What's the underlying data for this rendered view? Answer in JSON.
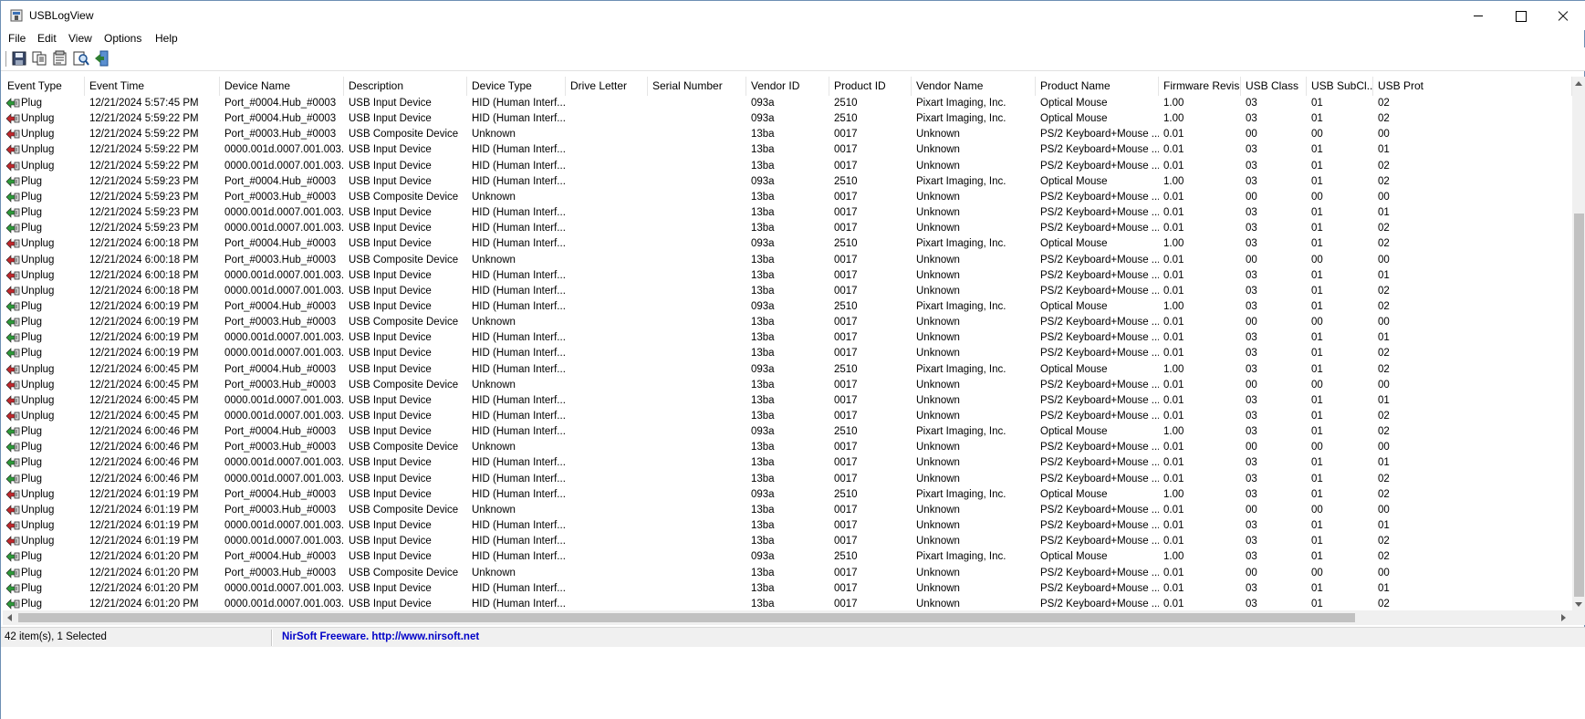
{
  "window": {
    "title": "USBLogView"
  },
  "menu": [
    "File",
    "Edit",
    "View",
    "Options",
    "Help"
  ],
  "toolbar": [
    {
      "name": "save-icon"
    },
    {
      "name": "copy-icon"
    },
    {
      "name": "properties-icon"
    },
    {
      "name": "find-icon"
    },
    {
      "name": "exit-icon"
    }
  ],
  "columns": [
    "Event Type",
    "Event Time",
    "Device Name",
    "Description",
    "Device Type",
    "Drive Letter",
    "Serial Number",
    "Vendor ID",
    "Product ID",
    "Vendor Name",
    "Product Name",
    "Firmware Revisi...",
    "USB Class",
    "USB SubCl...",
    "USB Prot"
  ],
  "rows": [
    [
      "Plug",
      "12/21/2024 5:57:45 PM",
      "Port_#0004.Hub_#0003",
      "USB Input Device",
      "HID (Human Interf...",
      "",
      "",
      "093a",
      "2510",
      "Pixart Imaging, Inc.",
      "Optical Mouse",
      "1.00",
      "03",
      "01",
      "02"
    ],
    [
      "Unplug",
      "12/21/2024 5:59:22 PM",
      "Port_#0004.Hub_#0003",
      "USB Input Device",
      "HID (Human Interf...",
      "",
      "",
      "093a",
      "2510",
      "Pixart Imaging, Inc.",
      "Optical Mouse",
      "1.00",
      "03",
      "01",
      "02"
    ],
    [
      "Unplug",
      "12/21/2024 5:59:22 PM",
      "Port_#0003.Hub_#0003",
      "USB Composite Device",
      "Unknown",
      "",
      "",
      "13ba",
      "0017",
      "Unknown",
      "PS/2 Keyboard+Mouse ...",
      "0.01",
      "00",
      "00",
      "00"
    ],
    [
      "Unplug",
      "12/21/2024 5:59:22 PM",
      "0000.001d.0007.001.003....",
      "USB Input Device",
      "HID (Human Interf...",
      "",
      "",
      "13ba",
      "0017",
      "Unknown",
      "PS/2 Keyboard+Mouse ...",
      "0.01",
      "03",
      "01",
      "01"
    ],
    [
      "Unplug",
      "12/21/2024 5:59:22 PM",
      "0000.001d.0007.001.003....",
      "USB Input Device",
      "HID (Human Interf...",
      "",
      "",
      "13ba",
      "0017",
      "Unknown",
      "PS/2 Keyboard+Mouse ...",
      "0.01",
      "03",
      "01",
      "02"
    ],
    [
      "Plug",
      "12/21/2024 5:59:23 PM",
      "Port_#0004.Hub_#0003",
      "USB Input Device",
      "HID (Human Interf...",
      "",
      "",
      "093a",
      "2510",
      "Pixart Imaging, Inc.",
      "Optical Mouse",
      "1.00",
      "03",
      "01",
      "02"
    ],
    [
      "Plug",
      "12/21/2024 5:59:23 PM",
      "Port_#0003.Hub_#0003",
      "USB Composite Device",
      "Unknown",
      "",
      "",
      "13ba",
      "0017",
      "Unknown",
      "PS/2 Keyboard+Mouse ...",
      "0.01",
      "00",
      "00",
      "00"
    ],
    [
      "Plug",
      "12/21/2024 5:59:23 PM",
      "0000.001d.0007.001.003....",
      "USB Input Device",
      "HID (Human Interf...",
      "",
      "",
      "13ba",
      "0017",
      "Unknown",
      "PS/2 Keyboard+Mouse ...",
      "0.01",
      "03",
      "01",
      "01"
    ],
    [
      "Plug",
      "12/21/2024 5:59:23 PM",
      "0000.001d.0007.001.003....",
      "USB Input Device",
      "HID (Human Interf...",
      "",
      "",
      "13ba",
      "0017",
      "Unknown",
      "PS/2 Keyboard+Mouse ...",
      "0.01",
      "03",
      "01",
      "02"
    ],
    [
      "Unplug",
      "12/21/2024 6:00:18 PM",
      "Port_#0004.Hub_#0003",
      "USB Input Device",
      "HID (Human Interf...",
      "",
      "",
      "093a",
      "2510",
      "Pixart Imaging, Inc.",
      "Optical Mouse",
      "1.00",
      "03",
      "01",
      "02"
    ],
    [
      "Unplug",
      "12/21/2024 6:00:18 PM",
      "Port_#0003.Hub_#0003",
      "USB Composite Device",
      "Unknown",
      "",
      "",
      "13ba",
      "0017",
      "Unknown",
      "PS/2 Keyboard+Mouse ...",
      "0.01",
      "00",
      "00",
      "00"
    ],
    [
      "Unplug",
      "12/21/2024 6:00:18 PM",
      "0000.001d.0007.001.003....",
      "USB Input Device",
      "HID (Human Interf...",
      "",
      "",
      "13ba",
      "0017",
      "Unknown",
      "PS/2 Keyboard+Mouse ...",
      "0.01",
      "03",
      "01",
      "01"
    ],
    [
      "Unplug",
      "12/21/2024 6:00:18 PM",
      "0000.001d.0007.001.003....",
      "USB Input Device",
      "HID (Human Interf...",
      "",
      "",
      "13ba",
      "0017",
      "Unknown",
      "PS/2 Keyboard+Mouse ...",
      "0.01",
      "03",
      "01",
      "02"
    ],
    [
      "Plug",
      "12/21/2024 6:00:19 PM",
      "Port_#0004.Hub_#0003",
      "USB Input Device",
      "HID (Human Interf...",
      "",
      "",
      "093a",
      "2510",
      "Pixart Imaging, Inc.",
      "Optical Mouse",
      "1.00",
      "03",
      "01",
      "02"
    ],
    [
      "Plug",
      "12/21/2024 6:00:19 PM",
      "Port_#0003.Hub_#0003",
      "USB Composite Device",
      "Unknown",
      "",
      "",
      "13ba",
      "0017",
      "Unknown",
      "PS/2 Keyboard+Mouse ...",
      "0.01",
      "00",
      "00",
      "00"
    ],
    [
      "Plug",
      "12/21/2024 6:00:19 PM",
      "0000.001d.0007.001.003....",
      "USB Input Device",
      "HID (Human Interf...",
      "",
      "",
      "13ba",
      "0017",
      "Unknown",
      "PS/2 Keyboard+Mouse ...",
      "0.01",
      "03",
      "01",
      "01"
    ],
    [
      "Plug",
      "12/21/2024 6:00:19 PM",
      "0000.001d.0007.001.003....",
      "USB Input Device",
      "HID (Human Interf...",
      "",
      "",
      "13ba",
      "0017",
      "Unknown",
      "PS/2 Keyboard+Mouse ...",
      "0.01",
      "03",
      "01",
      "02"
    ],
    [
      "Unplug",
      "12/21/2024 6:00:45 PM",
      "Port_#0004.Hub_#0003",
      "USB Input Device",
      "HID (Human Interf...",
      "",
      "",
      "093a",
      "2510",
      "Pixart Imaging, Inc.",
      "Optical Mouse",
      "1.00",
      "03",
      "01",
      "02"
    ],
    [
      "Unplug",
      "12/21/2024 6:00:45 PM",
      "Port_#0003.Hub_#0003",
      "USB Composite Device",
      "Unknown",
      "",
      "",
      "13ba",
      "0017",
      "Unknown",
      "PS/2 Keyboard+Mouse ...",
      "0.01",
      "00",
      "00",
      "00"
    ],
    [
      "Unplug",
      "12/21/2024 6:00:45 PM",
      "0000.001d.0007.001.003....",
      "USB Input Device",
      "HID (Human Interf...",
      "",
      "",
      "13ba",
      "0017",
      "Unknown",
      "PS/2 Keyboard+Mouse ...",
      "0.01",
      "03",
      "01",
      "01"
    ],
    [
      "Unplug",
      "12/21/2024 6:00:45 PM",
      "0000.001d.0007.001.003....",
      "USB Input Device",
      "HID (Human Interf...",
      "",
      "",
      "13ba",
      "0017",
      "Unknown",
      "PS/2 Keyboard+Mouse ...",
      "0.01",
      "03",
      "01",
      "02"
    ],
    [
      "Plug",
      "12/21/2024 6:00:46 PM",
      "Port_#0004.Hub_#0003",
      "USB Input Device",
      "HID (Human Interf...",
      "",
      "",
      "093a",
      "2510",
      "Pixart Imaging, Inc.",
      "Optical Mouse",
      "1.00",
      "03",
      "01",
      "02"
    ],
    [
      "Plug",
      "12/21/2024 6:00:46 PM",
      "Port_#0003.Hub_#0003",
      "USB Composite Device",
      "Unknown",
      "",
      "",
      "13ba",
      "0017",
      "Unknown",
      "PS/2 Keyboard+Mouse ...",
      "0.01",
      "00",
      "00",
      "00"
    ],
    [
      "Plug",
      "12/21/2024 6:00:46 PM",
      "0000.001d.0007.001.003....",
      "USB Input Device",
      "HID (Human Interf...",
      "",
      "",
      "13ba",
      "0017",
      "Unknown",
      "PS/2 Keyboard+Mouse ...",
      "0.01",
      "03",
      "01",
      "01"
    ],
    [
      "Plug",
      "12/21/2024 6:00:46 PM",
      "0000.001d.0007.001.003....",
      "USB Input Device",
      "HID (Human Interf...",
      "",
      "",
      "13ba",
      "0017",
      "Unknown",
      "PS/2 Keyboard+Mouse ...",
      "0.01",
      "03",
      "01",
      "02"
    ],
    [
      "Unplug",
      "12/21/2024 6:01:19 PM",
      "Port_#0004.Hub_#0003",
      "USB Input Device",
      "HID (Human Interf...",
      "",
      "",
      "093a",
      "2510",
      "Pixart Imaging, Inc.",
      "Optical Mouse",
      "1.00",
      "03",
      "01",
      "02"
    ],
    [
      "Unplug",
      "12/21/2024 6:01:19 PM",
      "Port_#0003.Hub_#0003",
      "USB Composite Device",
      "Unknown",
      "",
      "",
      "13ba",
      "0017",
      "Unknown",
      "PS/2 Keyboard+Mouse ...",
      "0.01",
      "00",
      "00",
      "00"
    ],
    [
      "Unplug",
      "12/21/2024 6:01:19 PM",
      "0000.001d.0007.001.003....",
      "USB Input Device",
      "HID (Human Interf...",
      "",
      "",
      "13ba",
      "0017",
      "Unknown",
      "PS/2 Keyboard+Mouse ...",
      "0.01",
      "03",
      "01",
      "01"
    ],
    [
      "Unplug",
      "12/21/2024 6:01:19 PM",
      "0000.001d.0007.001.003....",
      "USB Input Device",
      "HID (Human Interf...",
      "",
      "",
      "13ba",
      "0017",
      "Unknown",
      "PS/2 Keyboard+Mouse ...",
      "0.01",
      "03",
      "01",
      "02"
    ],
    [
      "Plug",
      "12/21/2024 6:01:20 PM",
      "Port_#0004.Hub_#0003",
      "USB Input Device",
      "HID (Human Interf...",
      "",
      "",
      "093a",
      "2510",
      "Pixart Imaging, Inc.",
      "Optical Mouse",
      "1.00",
      "03",
      "01",
      "02"
    ],
    [
      "Plug",
      "12/21/2024 6:01:20 PM",
      "Port_#0003.Hub_#0003",
      "USB Composite Device",
      "Unknown",
      "",
      "",
      "13ba",
      "0017",
      "Unknown",
      "PS/2 Keyboard+Mouse ...",
      "0.01",
      "00",
      "00",
      "00"
    ],
    [
      "Plug",
      "12/21/2024 6:01:20 PM",
      "0000.001d.0007.001.003....",
      "USB Input Device",
      "HID (Human Interf...",
      "",
      "",
      "13ba",
      "0017",
      "Unknown",
      "PS/2 Keyboard+Mouse ...",
      "0.01",
      "03",
      "01",
      "01"
    ],
    [
      "Plug",
      "12/21/2024 6:01:20 PM",
      "0000.001d.0007.001.003....",
      "USB Input Device",
      "HID (Human Interf...",
      "",
      "",
      "13ba",
      "0017",
      "Unknown",
      "PS/2 Keyboard+Mouse ...",
      "0.01",
      "03",
      "01",
      "02"
    ]
  ],
  "status": {
    "count": "42 item(s), 1 Selected",
    "link": "NirSoft Freeware.  http://www.nirsoft.net"
  },
  "colors": {
    "plug": "#2e9a3a",
    "unplug": "#c0282d",
    "link": "#0000c8"
  }
}
